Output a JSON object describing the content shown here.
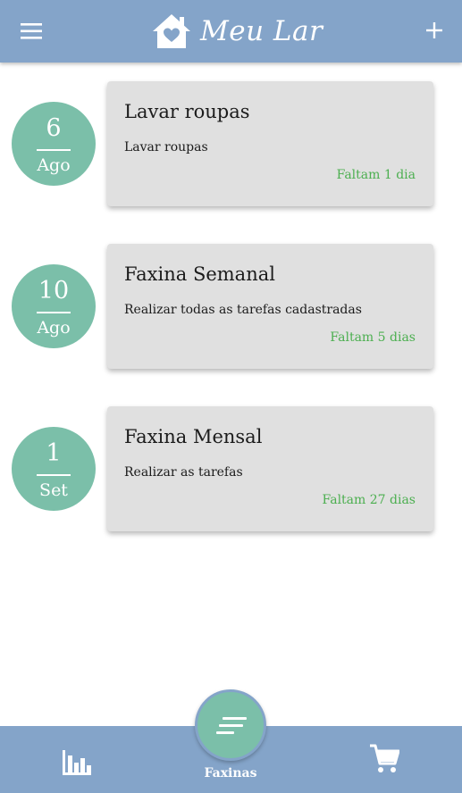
{
  "app": {
    "title": "Meu Lar",
    "icons": {
      "menu": "menu-icon",
      "logo": "house-heart-icon",
      "add": "plus-icon"
    }
  },
  "tasks": [
    {
      "day": "6",
      "month": "Ago",
      "title": "Lavar roupas",
      "description": "Lavar roupas",
      "due": "Faltam 1 dia"
    },
    {
      "day": "10",
      "month": "Ago",
      "title": "Faxina Semanal",
      "description": "Realizar todas as tarefas cadastradas",
      "due": "Faltam 5 dias"
    },
    {
      "day": "1",
      "month": "Set",
      "title": "Faxina Mensal",
      "description": "Realizar as tarefas",
      "due": "Faltam 27 dias"
    }
  ],
  "bottom_nav": {
    "active_label": "Faxinas",
    "icons": {
      "stats": "bar-chart-icon",
      "active": "notes-icon",
      "shopping": "shopping-cart-icon"
    }
  },
  "colors": {
    "primary": "#84a4c9",
    "accent": "#7bbfa9",
    "card": "#e0e0e0",
    "due_text": "#4caf50"
  }
}
